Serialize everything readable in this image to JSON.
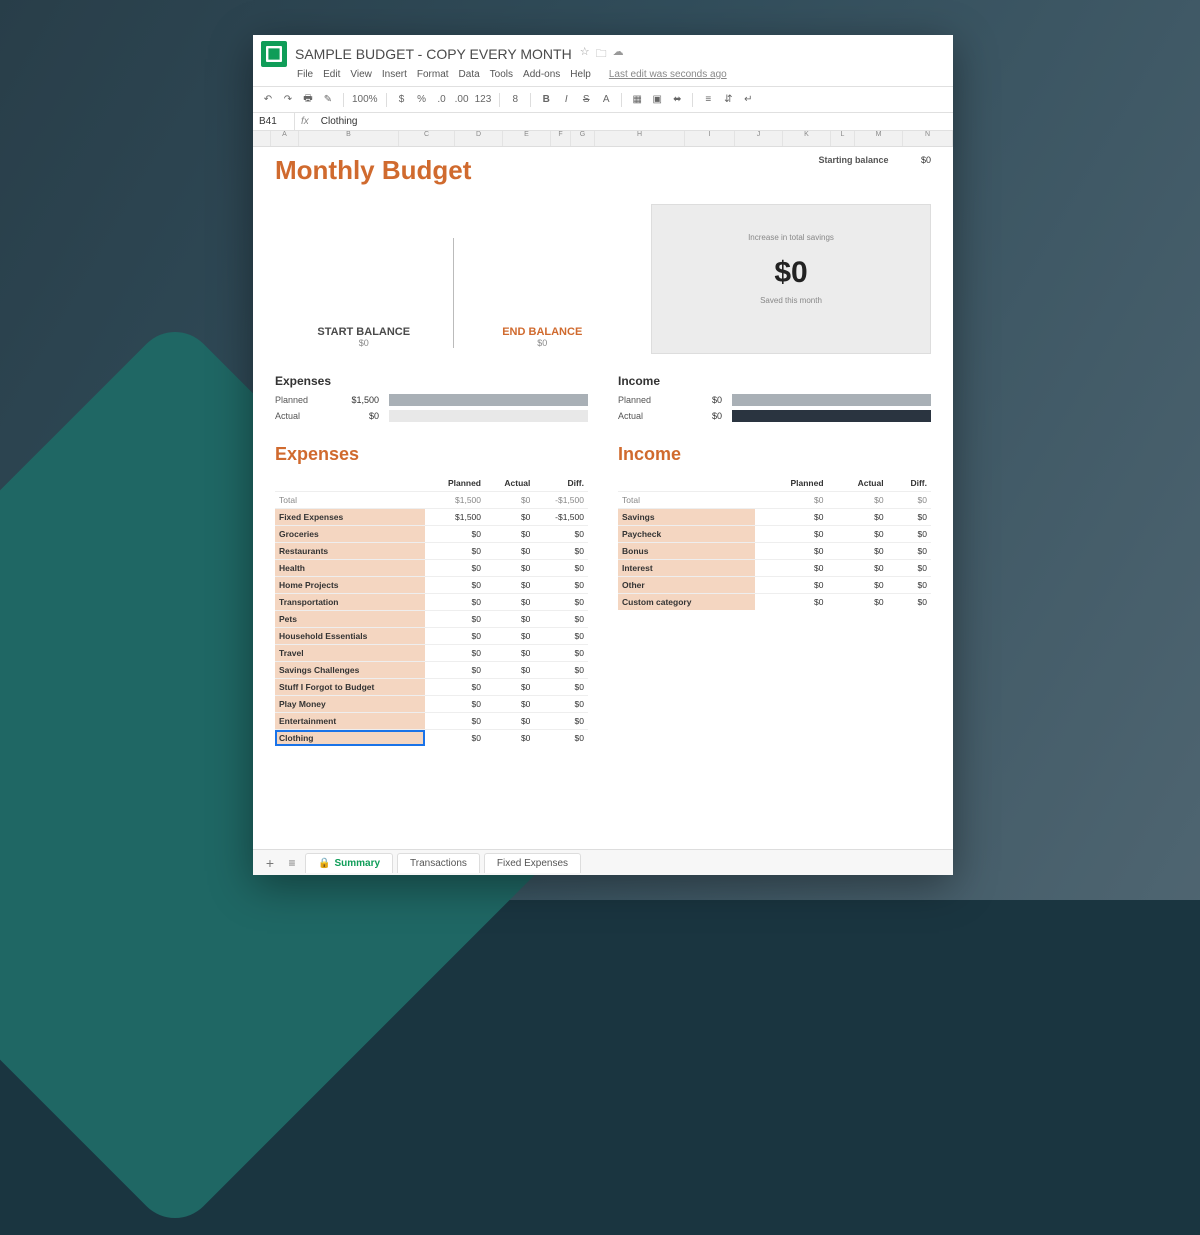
{
  "header": {
    "doc_title": "SAMPLE BUDGET - COPY EVERY MONTH",
    "last_edit": "Last edit was seconds ago"
  },
  "menu": [
    "File",
    "Edit",
    "View",
    "Insert",
    "Format",
    "Data",
    "Tools",
    "Add-ons",
    "Help"
  ],
  "toolbar": {
    "zoom": "100%",
    "money": "$",
    "pct": "%",
    "dec": ".0",
    "decinc": ".00",
    "num": "123",
    "fontsize": "8",
    "bold": "B",
    "italic": "I",
    "strike": "S"
  },
  "formula": {
    "cell": "B41",
    "value": "Clothing"
  },
  "cols": [
    "A",
    "B",
    "C",
    "D",
    "E",
    "F",
    "G",
    "H",
    "I",
    "J",
    "K",
    "L",
    "M",
    "N"
  ],
  "budget": {
    "title": "Monthly Budget",
    "starting_balance_label": "Starting balance",
    "starting_balance_value": "$0",
    "start_label": "START BALANCE",
    "start_value": "$0",
    "end_label": "END BALANCE",
    "end_value": "$0",
    "savings_top": "Increase in total savings",
    "savings_big": "$0",
    "savings_bot": "Saved this month"
  },
  "bars": {
    "expenses_h": "Expenses",
    "income_h": "Income",
    "planned_l": "Planned",
    "actual_l": "Actual",
    "exp_planned": "$1,500",
    "exp_actual": "$0",
    "inc_planned": "$0",
    "inc_actual": "$0"
  },
  "exp_table": {
    "h": "Expenses",
    "cols": [
      "",
      "Planned",
      "Actual",
      "Diff."
    ],
    "total": [
      "Total",
      "$1,500",
      "$0",
      "-$1,500"
    ],
    "rows": [
      [
        "Fixed Expenses",
        "$1,500",
        "$0",
        "-$1,500"
      ],
      [
        "Groceries",
        "$0",
        "$0",
        "$0"
      ],
      [
        "Restaurants",
        "$0",
        "$0",
        "$0"
      ],
      [
        "Health",
        "$0",
        "$0",
        "$0"
      ],
      [
        "Home Projects",
        "$0",
        "$0",
        "$0"
      ],
      [
        "Transportation",
        "$0",
        "$0",
        "$0"
      ],
      [
        "Pets",
        "$0",
        "$0",
        "$0"
      ],
      [
        "Household Essentials",
        "$0",
        "$0",
        "$0"
      ],
      [
        "Travel",
        "$0",
        "$0",
        "$0"
      ],
      [
        "Savings Challenges",
        "$0",
        "$0",
        "$0"
      ],
      [
        "Stuff I Forgot to Budget",
        "$0",
        "$0",
        "$0"
      ],
      [
        "Play Money",
        "$0",
        "$0",
        "$0"
      ],
      [
        "Entertainment",
        "$0",
        "$0",
        "$0"
      ],
      [
        "Clothing",
        "$0",
        "$0",
        "$0"
      ]
    ]
  },
  "inc_table": {
    "h": "Income",
    "cols": [
      "",
      "Planned",
      "Actual",
      "Diff."
    ],
    "total": [
      "Total",
      "$0",
      "$0",
      "$0"
    ],
    "rows": [
      [
        "Savings",
        "$0",
        "$0",
        "$0"
      ],
      [
        "Paycheck",
        "$0",
        "$0",
        "$0"
      ],
      [
        "Bonus",
        "$0",
        "$0",
        "$0"
      ],
      [
        "Interest",
        "$0",
        "$0",
        "$0"
      ],
      [
        "Other",
        "$0",
        "$0",
        "$0"
      ],
      [
        "Custom category",
        "$0",
        "$0",
        "$0"
      ]
    ]
  },
  "tabs": {
    "active": "Summary",
    "others": [
      "Transactions",
      "Fixed Expenses"
    ]
  }
}
